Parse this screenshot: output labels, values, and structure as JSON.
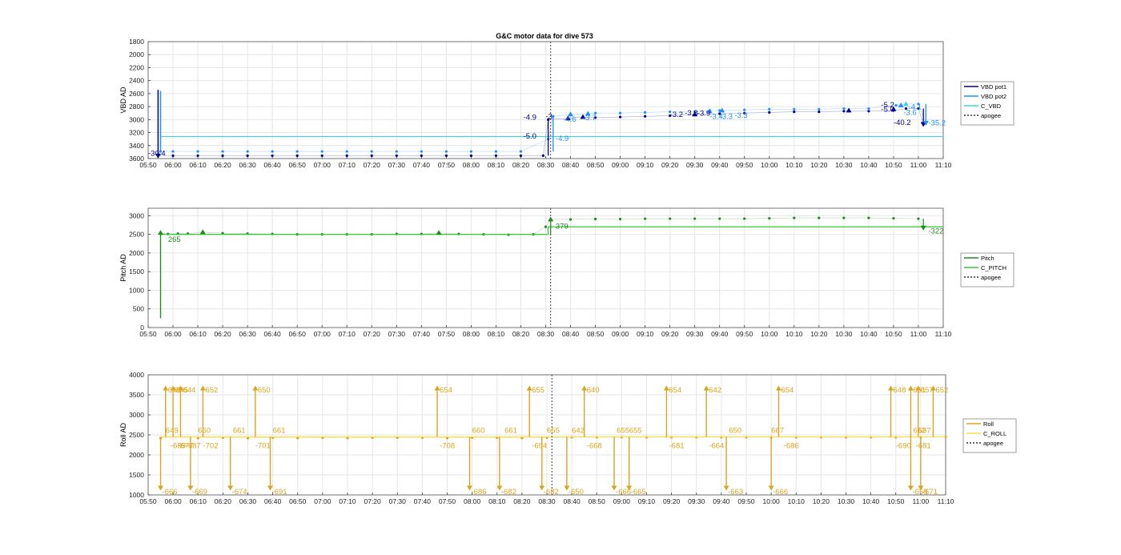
{
  "figure": {
    "title": "G&C motor data for dive 573"
  },
  "colors": {
    "vbd_pot1": "#00008B",
    "vbd_pot2": "#1E90FF",
    "c_vbd": "#3FD3E6",
    "pitch": "#228B22",
    "c_pitch": "#33CC33",
    "roll": "#DAA520",
    "c_roll": "#F2E24A",
    "apogee": "#333333",
    "grid": "#e6e6e6"
  },
  "chart_data": [
    {
      "type": "line",
      "id": "vbd",
      "title": "G&C motor data for dive 573",
      "ylabel": "VBD AD",
      "y_reversed": true,
      "ylim": [
        1800,
        3600
      ],
      "yticks": [
        1800,
        2000,
        2200,
        2400,
        2600,
        2800,
        3000,
        3200,
        3400,
        3600
      ],
      "xlim": [
        "05:50",
        "11:10"
      ],
      "xticks": [
        "05:50",
        "06:00",
        "06:10",
        "06:20",
        "06:30",
        "06:40",
        "06:50",
        "07:00",
        "07:10",
        "07:20",
        "07:30",
        "07:40",
        "07:50",
        "08:00",
        "08:10",
        "08:20",
        "08:30",
        "08:40",
        "08:50",
        "09:00",
        "09:10",
        "09:20",
        "09:30",
        "09:40",
        "09:50",
        "10:00",
        "10:10",
        "10:20",
        "10:30",
        "10:40",
        "10:50",
        "11:00",
        "11:10"
      ],
      "grid": true,
      "legend": {
        "position": "right",
        "entries": [
          "VBD pot1",
          "VBD pot2",
          "C_VBD",
          "apogee"
        ]
      },
      "series": [
        {
          "name": "VBD pot1",
          "color_key": "vbd_pot1",
          "x": [
            "05:54",
            "06:00",
            "06:10",
            "06:20",
            "06:30",
            "06:40",
            "06:50",
            "07:00",
            "07:10",
            "07:20",
            "07:30",
            "07:40",
            "07:50",
            "08:00",
            "08:10",
            "08:20",
            "08:29",
            "08:31",
            "08:39",
            "08:45",
            "08:50",
            "09:00",
            "09:10",
            "09:20",
            "09:30",
            "09:40",
            "09:50",
            "10:00",
            "10:10",
            "10:20",
            "10:30",
            "10:40",
            "10:50",
            "10:55",
            "11:00",
            "11:02"
          ],
          "y": [
            3550,
            3555,
            3555,
            3555,
            3555,
            3555,
            3555,
            3555,
            3555,
            3555,
            3555,
            3555,
            3555,
            3555,
            3555,
            3555,
            3555,
            3000,
            2980,
            2960,
            2970,
            2960,
            2950,
            2940,
            2920,
            2910,
            2900,
            2890,
            2880,
            2880,
            2870,
            2870,
            2860,
            2830,
            2830,
            3070
          ]
        },
        {
          "name": "VBD pot2",
          "color_key": "vbd_pot2",
          "x": [
            "05:55",
            "06:00",
            "06:10",
            "06:20",
            "06:30",
            "06:40",
            "06:50",
            "07:00",
            "07:10",
            "07:20",
            "07:30",
            "07:40",
            "07:50",
            "08:00",
            "08:10",
            "08:20",
            "08:31",
            "08:33",
            "08:40",
            "08:47",
            "08:50",
            "09:00",
            "09:10",
            "09:20",
            "09:30",
            "09:36",
            "09:40",
            "09:50",
            "10:00",
            "10:10",
            "10:20",
            "10:30",
            "10:40",
            "10:51",
            "10:55",
            "11:00",
            "11:03"
          ],
          "y": [
            3490,
            3490,
            3490,
            3490,
            3490,
            3490,
            3490,
            3490,
            3490,
            3490,
            3490,
            3490,
            3490,
            3490,
            3490,
            3490,
            3300,
            2950,
            2920,
            2910,
            2900,
            2900,
            2890,
            2880,
            2880,
            2860,
            2860,
            2850,
            2840,
            2840,
            2840,
            2830,
            2830,
            2780,
            2760,
            2760,
            3050
          ]
        },
        {
          "name": "C_VBD",
          "color_key": "c_vbd",
          "x": [
            "05:55",
            "11:10"
          ],
          "y": [
            3260,
            3260
          ]
        }
      ],
      "annotations": [
        {
          "x": "05:50",
          "y": 3555,
          "text": "-30.4",
          "color_key": "vbd_pot1"
        },
        {
          "x": "08:21",
          "y": 3000,
          "text": "-4.9",
          "color_key": "vbd_pot1"
        },
        {
          "x": "08:21",
          "y": 3290,
          "text": "-5.0",
          "color_key": "vbd_pot1"
        },
        {
          "x": "08:30",
          "y": 2990,
          "text": "-3",
          "color_key": "vbd_pot1"
        },
        {
          "x": "08:34",
          "y": 3330,
          "text": "-4.9",
          "color_key": "vbd_pot2"
        },
        {
          "x": "08:37",
          "y": 3030,
          "text": "-4.6",
          "color_key": "vbd_pot2"
        },
        {
          "x": "08:45",
          "y": 3010,
          "text": "-3.7",
          "color_key": "vbd_pot2"
        },
        {
          "x": "09:20",
          "y": 2960,
          "text": "-3.2",
          "color_key": "vbd_pot1"
        },
        {
          "x": "09:26",
          "y": 2935,
          "text": "-3.8",
          "color_key": "vbd_pot1"
        },
        {
          "x": "09:31",
          "y": 2940,
          "text": "-3.9",
          "color_key": "vbd_pot1"
        },
        {
          "x": "09:36",
          "y": 2990,
          "text": "-3.4",
          "color_key": "vbd_pot2"
        },
        {
          "x": "09:40",
          "y": 2990,
          "text": "-3.3",
          "color_key": "vbd_pot2"
        },
        {
          "x": "09:46",
          "y": 2970,
          "text": "-3.3",
          "color_key": "vbd_pot2"
        },
        {
          "x": "10:45",
          "y": 2810,
          "text": "-5.2",
          "color_key": "vbd_pot1"
        },
        {
          "x": "10:45",
          "y": 2880,
          "text": "-5.0",
          "color_key": "vbd_pot1"
        },
        {
          "x": "10:56",
          "y": 2840,
          "text": "-4.1",
          "color_key": "vbd_pot2"
        },
        {
          "x": "10:54",
          "y": 2930,
          "text": "-3.6",
          "color_key": "vbd_pot2"
        },
        {
          "x": "10:50",
          "y": 3080,
          "text": "-40.2",
          "color_key": "vbd_pot1"
        },
        {
          "x": "11:04",
          "y": 3090,
          "text": "-35.2",
          "color_key": "vbd_pot2"
        }
      ]
    },
    {
      "type": "line",
      "id": "pitch",
      "ylabel": "Pitch AD",
      "y_reversed": false,
      "ylim": [
        0,
        3200
      ],
      "yticks": [
        0,
        500,
        1000,
        1500,
        2000,
        2500,
        3000
      ],
      "xlim": [
        "05:50",
        "11:10"
      ],
      "xticks": [
        "05:50",
        "06:00",
        "06:10",
        "06:20",
        "06:30",
        "06:40",
        "06:50",
        "07:00",
        "07:10",
        "07:20",
        "07:30",
        "07:40",
        "07:50",
        "08:00",
        "08:10",
        "08:20",
        "08:30",
        "08:40",
        "08:50",
        "09:00",
        "09:10",
        "09:20",
        "09:30",
        "09:40",
        "09:50",
        "10:00",
        "10:10",
        "10:20",
        "10:30",
        "10:40",
        "10:50",
        "11:00",
        "11:10"
      ],
      "grid": true,
      "legend": {
        "position": "right",
        "entries": [
          "Pitch",
          "C_PITCH",
          "apogee"
        ]
      },
      "series": [
        {
          "name": "Pitch",
          "color_key": "pitch",
          "x": [
            "05:55",
            "05:58",
            "06:02",
            "06:06",
            "06:12",
            "06:20",
            "06:30",
            "06:40",
            "06:50",
            "07:00",
            "07:10",
            "07:20",
            "07:30",
            "07:40",
            "07:47",
            "07:55",
            "08:05",
            "08:15",
            "08:25",
            "08:30",
            "08:32",
            "08:40",
            "08:50",
            "09:00",
            "09:10",
            "09:20",
            "09:30",
            "09:40",
            "09:50",
            "10:00",
            "10:10",
            "10:20",
            "10:30",
            "10:40",
            "10:50",
            "11:00",
            "11:02"
          ],
          "y": [
            2540,
            2510,
            2520,
            2520,
            2560,
            2530,
            2520,
            2510,
            2500,
            2500,
            2500,
            2500,
            2510,
            2510,
            2540,
            2510,
            2500,
            2490,
            2500,
            2700,
            2900,
            2900,
            2910,
            2910,
            2920,
            2920,
            2920,
            2920,
            2920,
            2930,
            2940,
            2940,
            2940,
            2940,
            2930,
            2920,
            2680
          ]
        },
        {
          "name": "C_PITCH",
          "color_key": "c_pitch",
          "x": [
            "05:55",
            "08:31",
            "08:31",
            "11:10"
          ],
          "y": [
            2500,
            2500,
            2700,
            2700
          ]
        }
      ],
      "annotations": [
        {
          "x": "05:58",
          "y": 2300,
          "text": "265",
          "color_key": "pitch"
        },
        {
          "x": "08:34",
          "y": 2650,
          "text": "379",
          "color_key": "pitch"
        },
        {
          "x": "11:04",
          "y": 2520,
          "text": "-322",
          "color_key": "pitch"
        }
      ]
    },
    {
      "type": "line",
      "id": "roll",
      "ylabel": "Roll AD",
      "y_reversed": false,
      "ylim": [
        1000,
        4000
      ],
      "yticks": [
        1000,
        1500,
        2000,
        2500,
        3000,
        3500,
        4000
      ],
      "xlim": [
        "05:50",
        "11:10"
      ],
      "xticks": [
        "05:50",
        "06:00",
        "06:10",
        "06:20",
        "06:30",
        "06:40",
        "06:50",
        "07:00",
        "07:10",
        "07:20",
        "07:30",
        "07:40",
        "07:50",
        "08:00",
        "08:10",
        "08:20",
        "08:30",
        "08:40",
        "08:50",
        "09:00",
        "09:10",
        "09:20",
        "09:30",
        "09:40",
        "09:50",
        "10:00",
        "10:10",
        "10:20",
        "10:30",
        "10:40",
        "10:50",
        "11:00",
        "11:10"
      ],
      "grid": true,
      "legend": {
        "position": "right",
        "entries": [
          "Roll",
          "C_ROLL",
          "apogee"
        ]
      },
      "series": [
        {
          "name": "Roll",
          "color_key": "roll",
          "x": [
            "05:55",
            "06:10",
            "06:20",
            "06:30",
            "06:40",
            "06:50",
            "07:00",
            "07:10",
            "07:20",
            "07:30",
            "07:40",
            "07:50",
            "08:00",
            "08:10",
            "08:20",
            "08:30",
            "08:40",
            "08:50",
            "09:00",
            "09:10",
            "09:20",
            "09:30",
            "09:40",
            "09:50",
            "10:00",
            "10:10",
            "10:20",
            "10:30",
            "10:40",
            "10:50",
            "11:00",
            "11:10"
          ],
          "y": [
            2420,
            2420,
            2430,
            2420,
            2430,
            2420,
            2430,
            2420,
            2430,
            2430,
            2430,
            2420,
            2430,
            2430,
            2420,
            2430,
            2440,
            2440,
            2440,
            2440,
            2440,
            2440,
            2440,
            2440,
            2440,
            2440,
            2440,
            2440,
            2440,
            2440,
            2440,
            2450
          ]
        },
        {
          "name": "C_ROLL",
          "color_key": "c_roll",
          "x": [
            "05:55",
            "11:10"
          ],
          "y": [
            2450,
            2450
          ]
        }
      ],
      "spikes_up": [
        {
          "x": "05:57",
          "text": "648"
        },
        {
          "x": "06:00",
          "text": "645"
        },
        {
          "x": "06:03",
          "text": "644"
        },
        {
          "x": "06:12",
          "text": "652"
        },
        {
          "x": "06:33",
          "text": "650"
        },
        {
          "x": "07:46",
          "text": "654"
        },
        {
          "x": "08:23",
          "text": "655"
        },
        {
          "x": "08:45",
          "text": "640"
        },
        {
          "x": "09:18",
          "text": "654"
        },
        {
          "x": "09:34",
          "text": "642"
        },
        {
          "x": "10:03",
          "text": "654"
        },
        {
          "x": "10:48",
          "text": "648"
        },
        {
          "x": "10:56",
          "text": "651"
        },
        {
          "x": "10:59",
          "text": "657"
        },
        {
          "x": "11:05",
          "text": "652"
        }
      ],
      "spikes_down": [
        {
          "x": "05:55",
          "text": "-666"
        },
        {
          "x": "06:07",
          "text": "-669"
        },
        {
          "x": "06:23",
          "text": "-674"
        },
        {
          "x": "06:39",
          "text": "-691"
        },
        {
          "x": "07:59",
          "text": "-686"
        },
        {
          "x": "08:11",
          "text": "-682"
        },
        {
          "x": "08:28",
          "text": "-682"
        },
        {
          "x": "08:38",
          "text": "-650"
        },
        {
          "x": "08:57",
          "text": "-666"
        },
        {
          "x": "09:03",
          "text": "-665"
        },
        {
          "x": "09:42",
          "text": "-663"
        },
        {
          "x": "10:00",
          "text": "-666"
        },
        {
          "x": "10:56",
          "text": "-658"
        },
        {
          "x": "11:00",
          "text": "-671"
        }
      ],
      "annotations": [
        {
          "x": "05:57",
          "y": 2550,
          "text": "649",
          "color_key": "roll"
        },
        {
          "x": "05:59",
          "y": 2170,
          "text": "-689",
          "color_key": "roll"
        },
        {
          "x": "06:02",
          "y": 2170,
          "text": "-677",
          "color_key": "roll"
        },
        {
          "x": "06:05",
          "y": 2170,
          "text": "-687",
          "color_key": "roll"
        },
        {
          "x": "06:10",
          "y": 2550,
          "text": "660",
          "color_key": "roll"
        },
        {
          "x": "06:12",
          "y": 2170,
          "text": "-702",
          "color_key": "roll"
        },
        {
          "x": "06:24",
          "y": 2550,
          "text": "661",
          "color_key": "roll"
        },
        {
          "x": "06:33",
          "y": 2170,
          "text": "-701",
          "color_key": "roll"
        },
        {
          "x": "06:40",
          "y": 2550,
          "text": "661",
          "color_key": "roll"
        },
        {
          "x": "07:47",
          "y": 2170,
          "text": "-708",
          "color_key": "roll"
        },
        {
          "x": "08:00",
          "y": 2550,
          "text": "660",
          "color_key": "roll"
        },
        {
          "x": "08:13",
          "y": 2550,
          "text": "661",
          "color_key": "roll"
        },
        {
          "x": "08:24",
          "y": 2170,
          "text": "-694",
          "color_key": "roll"
        },
        {
          "x": "08:30",
          "y": 2550,
          "text": "655",
          "color_key": "roll"
        },
        {
          "x": "08:40",
          "y": 2550,
          "text": "642",
          "color_key": "roll"
        },
        {
          "x": "08:46",
          "y": 2170,
          "text": "-668",
          "color_key": "roll"
        },
        {
          "x": "08:58",
          "y": 2550,
          "text": "655",
          "color_key": "roll"
        },
        {
          "x": "09:03",
          "y": 2550,
          "text": "655",
          "color_key": "roll"
        },
        {
          "x": "09:19",
          "y": 2170,
          "text": "-681",
          "color_key": "roll"
        },
        {
          "x": "09:35",
          "y": 2170,
          "text": "-664",
          "color_key": "roll"
        },
        {
          "x": "09:43",
          "y": 2550,
          "text": "650",
          "color_key": "roll"
        },
        {
          "x": "10:00",
          "y": 2550,
          "text": "667",
          "color_key": "roll"
        },
        {
          "x": "10:05",
          "y": 2170,
          "text": "-686",
          "color_key": "roll"
        },
        {
          "x": "10:50",
          "y": 2170,
          "text": "-690",
          "color_key": "roll"
        },
        {
          "x": "10:57",
          "y": 2550,
          "text": "652",
          "color_key": "roll"
        },
        {
          "x": "10:59",
          "y": 2550,
          "text": "657",
          "color_key": "roll"
        },
        {
          "x": "10:58",
          "y": 2170,
          "text": "-681",
          "color_key": "roll"
        }
      ]
    }
  ],
  "apogee_time": "08:32"
}
